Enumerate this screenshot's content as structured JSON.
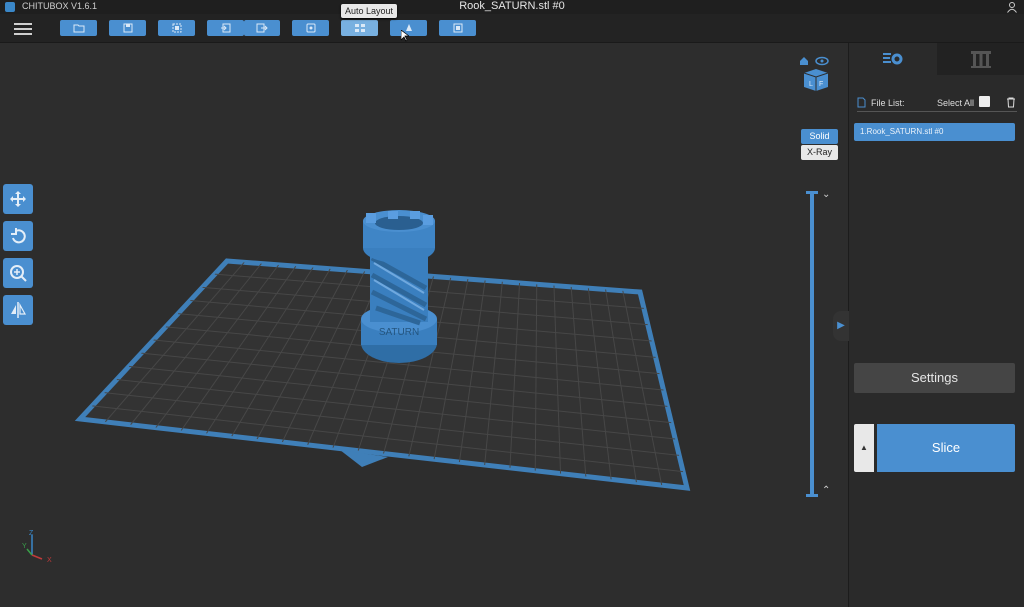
{
  "titlebar": {
    "app_name": "CHITUBOX V1.6.1",
    "file_title": "Rook_SATURN.stl #0"
  },
  "toolbar": {
    "tooltip": "Auto Layout",
    "buttons": [
      "open-file-icon",
      "save-icon",
      "select-all-icon",
      "import-icon",
      "export-icon",
      "undo-icon",
      "auto-layout-icon",
      "auto-support-icon",
      "hollow-icon"
    ]
  },
  "viewport": {
    "mode_solid": "Solid",
    "mode_xray": "X-Ray",
    "layer_up": "⌄",
    "layer_down": "⌃",
    "model_text": "SATURN",
    "axis": {
      "z": "Z",
      "y": "Y",
      "x": "X"
    }
  },
  "panel": {
    "file_list_label": "File List:",
    "select_all_label": "Select All",
    "files": [
      "1.Rook_SATURN.stl #0"
    ],
    "settings_label": "Settings",
    "slice_label": "Slice",
    "slice_toggle": "▲",
    "collapse": "▶"
  },
  "colors": {
    "accent": "#4a8fd0",
    "background": "#2e2e2e",
    "panel": "#2a2a2a"
  }
}
